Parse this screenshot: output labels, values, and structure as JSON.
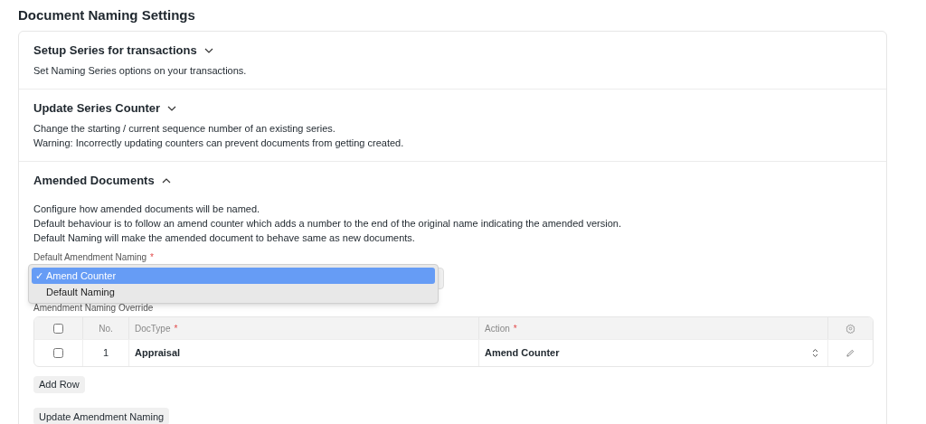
{
  "page_title": "Document Naming Settings",
  "sections": [
    {
      "title": "Setup Series for transactions",
      "expanded": false,
      "lines": [
        "Set Naming Series options on your transactions."
      ]
    },
    {
      "title": "Update Series Counter",
      "expanded": false,
      "lines": [
        "Change the starting / current sequence number of an existing series.",
        "Warning: Incorrectly updating counters can prevent documents from getting created."
      ]
    },
    {
      "title": "Amended Documents",
      "expanded": true,
      "lines": [
        "Configure how amended documents will be named.",
        "Default behaviour is to follow an amend counter which adds a number to the end of the original name indicating the amended version.",
        "Default Naming will make the amended document to behave same as new documents."
      ]
    }
  ],
  "amendment_field": {
    "label": "Default Amendment Naming",
    "required_mark": "*",
    "check_mark": "✓",
    "options": [
      {
        "label": "Amend Counter",
        "selected": true
      },
      {
        "label": "Default Naming",
        "selected": false
      }
    ]
  },
  "override_table": {
    "label": "Amendment Naming Override",
    "select_all_checked": false,
    "columns": [
      {
        "label": "No."
      },
      {
        "label": "DocType",
        "required_mark": "*"
      },
      {
        "label": "Action",
        "required_mark": "*"
      }
    ],
    "rows": [
      {
        "checked": false,
        "no": "1",
        "doctype": "Appraisal",
        "action": "Amend Counter"
      }
    ]
  },
  "buttons": [
    "Add Row",
    "Update Amendment Naming"
  ]
}
